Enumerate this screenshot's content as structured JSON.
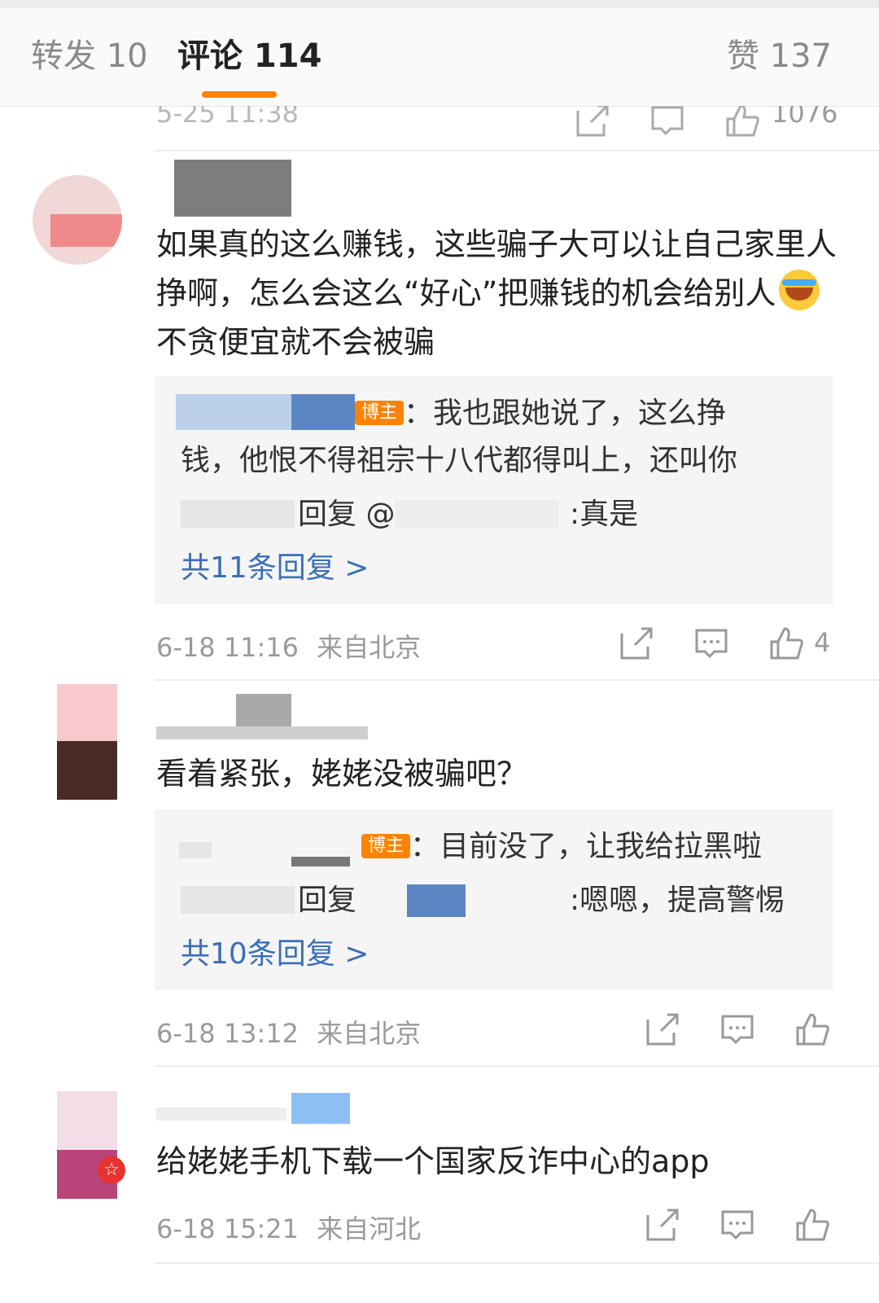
{
  "tabs": {
    "repost_label": "转发 10",
    "comment_label": "评论 114",
    "like_label": "赞 137"
  },
  "previous": {
    "time": "5-25 11:38",
    "like_count": "1076"
  },
  "comments": [
    {
      "text": "如果真的这么赚钱，这些骗子大可以让自己家里人挣啊，怎么会这么“好心”把赚钱的机会给别人",
      "text_tail": "不贪便宜就不会被骗",
      "emoji": "laugh-cry-emoji",
      "replies": [
        {
          "badge": "博主",
          "text": "：我也跟她说了，这么挣",
          "text2": "钱，他恨不得祖宗十八代都得叫上，还叫你"
        },
        {
          "reply_word": "回复 @",
          "text": ":真是"
        }
      ],
      "more_replies": "共11条回复 >",
      "time": "6-18 11:16",
      "location": "来自北京",
      "like_count": "4"
    },
    {
      "text": "看着紧张，姥姥没被骗吧？",
      "replies": [
        {
          "badge": "博主",
          "text": "：目前没了，让我给拉黑啦"
        },
        {
          "reply_word": "回复",
          "text": ":嗯嗯，提高警惕"
        }
      ],
      "more_replies": "共10条回复 >",
      "time": "6-18 13:12",
      "location": "来自北京",
      "like_count": ""
    },
    {
      "text": "给姥姥手机下载一个国家反诈中心的app",
      "time": "6-18 15:21",
      "location": "来自河北",
      "like_count": ""
    }
  ]
}
